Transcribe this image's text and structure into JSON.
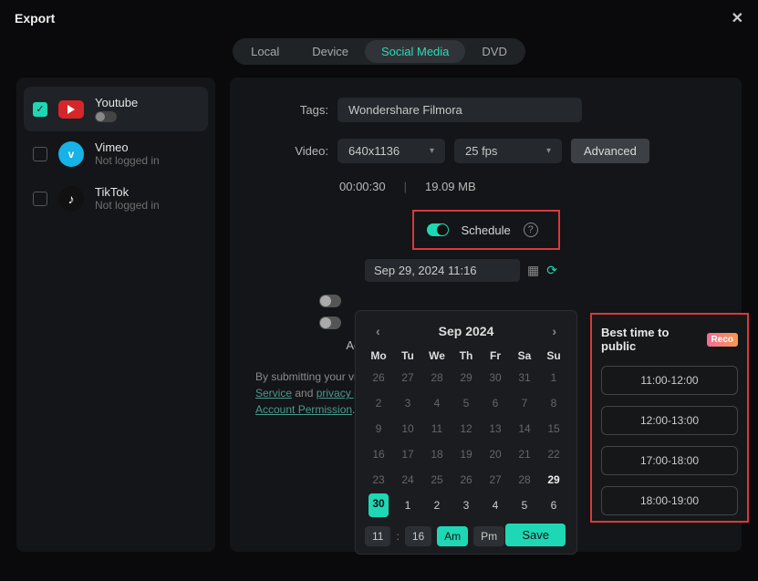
{
  "window": {
    "title": "Export"
  },
  "tabs": {
    "local": "Local",
    "device": "Device",
    "social": "Social Media",
    "dvd": "DVD"
  },
  "platforms": {
    "youtube": {
      "name": "Youtube",
      "sub": ""
    },
    "vimeo": {
      "name": "Vimeo",
      "sub": "Not logged in"
    },
    "tiktok": {
      "name": "TikTok",
      "sub": "Not logged in"
    }
  },
  "form": {
    "tags_label": "Tags:",
    "tags_value": "Wondershare Filmora",
    "video_label": "Video:",
    "resolution": "640x1136",
    "fps": "25 fps",
    "advanced": "Advanced",
    "duration": "00:00:30",
    "size": "19.09 MB",
    "schedule_label": "Schedule",
    "schedule_datetime": "Sep 29, 2024  11:16",
    "account_label": "Account:",
    "legal_prefix": "By submitting your video",
    "legal_service": "Service",
    "legal_and": " and ",
    "legal_privacy": "privacy polici",
    "legal_acct": "Account Permission"
  },
  "calendar": {
    "month_label": "Sep  2024",
    "dows": [
      "Mo",
      "Tu",
      "We",
      "Th",
      "Fr",
      "Sa",
      "Su"
    ],
    "weeks": [
      [
        {
          "d": "26"
        },
        {
          "d": "27"
        },
        {
          "d": "28"
        },
        {
          "d": "29"
        },
        {
          "d": "30"
        },
        {
          "d": "31"
        },
        {
          "d": "1"
        }
      ],
      [
        {
          "d": "2"
        },
        {
          "d": "3"
        },
        {
          "d": "4"
        },
        {
          "d": "5"
        },
        {
          "d": "6"
        },
        {
          "d": "7"
        },
        {
          "d": "8"
        }
      ],
      [
        {
          "d": "9"
        },
        {
          "d": "10"
        },
        {
          "d": "11"
        },
        {
          "d": "12"
        },
        {
          "d": "13"
        },
        {
          "d": "14"
        },
        {
          "d": "15"
        }
      ],
      [
        {
          "d": "16"
        },
        {
          "d": "17"
        },
        {
          "d": "18"
        },
        {
          "d": "19"
        },
        {
          "d": "20"
        },
        {
          "d": "21"
        },
        {
          "d": "22"
        }
      ],
      [
        {
          "d": "23"
        },
        {
          "d": "24"
        },
        {
          "d": "25"
        },
        {
          "d": "26"
        },
        {
          "d": "27"
        },
        {
          "d": "28"
        },
        {
          "d": "29",
          "bold": true
        }
      ],
      [
        {
          "d": "30",
          "sel": true
        },
        {
          "d": "1",
          "cur": true
        },
        {
          "d": "2",
          "cur": true
        },
        {
          "d": "3",
          "cur": true
        },
        {
          "d": "4",
          "cur": true
        },
        {
          "d": "5",
          "cur": true
        },
        {
          "d": "6",
          "cur": true
        }
      ]
    ],
    "hour": "11",
    "minute": "16",
    "am": "Am",
    "pm": "Pm",
    "save": "Save"
  },
  "best": {
    "title": "Best time to public",
    "badge": "Reco",
    "slots": [
      "11:00-12:00",
      "12:00-13:00",
      "17:00-18:00",
      "18:00-19:00"
    ]
  }
}
